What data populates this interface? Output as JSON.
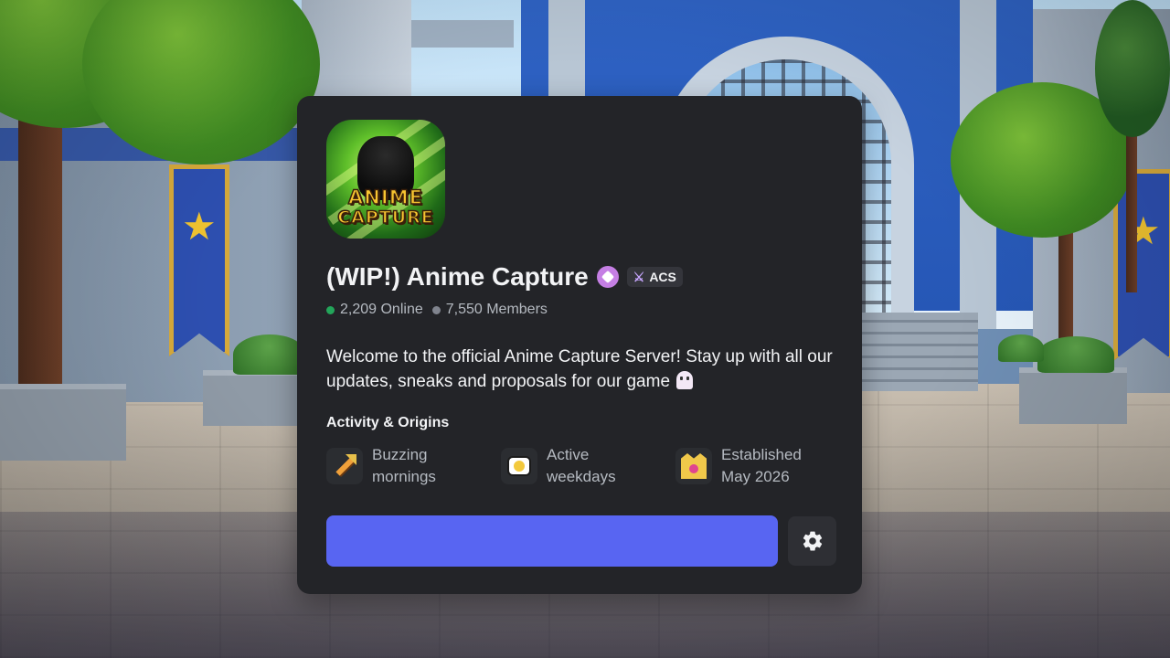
{
  "server": {
    "name": "(WIP!) Anime Capture",
    "tag": "ACS",
    "online_count": "2,209 Online",
    "member_count": "7,550 Members",
    "description": "Welcome to the official Anime Capture Server! Stay up with all our updates, sneaks and proposals for our game",
    "icon_logo_text": [
      "ANIME",
      "CAPTURE"
    ]
  },
  "activity": {
    "heading": "Activity & Origins",
    "traits": [
      {
        "line1": "Buzzing",
        "line2": "mornings",
        "icon": "pixel-arrow-icon"
      },
      {
        "line1": "Active",
        "line2": "weekdays",
        "icon": "speech-bubble-icon"
      },
      {
        "line1": "Established",
        "line2": "May 2026",
        "icon": "crown-icon"
      }
    ]
  },
  "actions": {
    "join_label": "",
    "settings_icon": "gear-icon"
  },
  "colors": {
    "card_bg": "#232428",
    "primary_button": "#5865f2",
    "online_dot": "#23a55a",
    "members_dot": "#80848e"
  }
}
